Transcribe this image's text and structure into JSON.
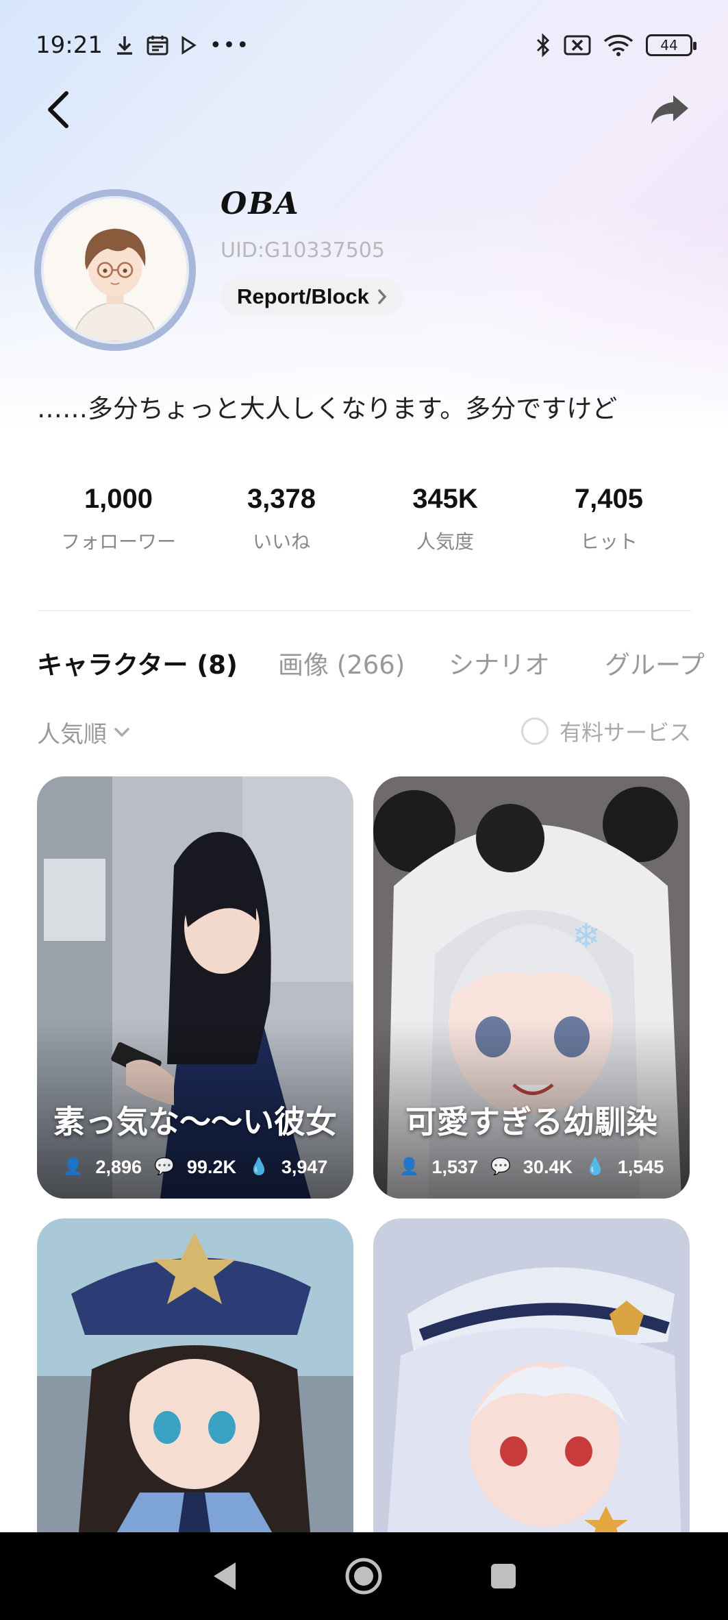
{
  "status_bar": {
    "time": "19:21",
    "battery": "44"
  },
  "profile": {
    "username": "OBA",
    "uid": "UID:G10337505",
    "report_label": "Report/Block",
    "bio": "……多分ちょっと大人しくなります。多分ですけど"
  },
  "stats": [
    {
      "value": "1,000",
      "label": "フォローワー"
    },
    {
      "value": "3,378",
      "label": "いいね"
    },
    {
      "value": "345K",
      "label": "人気度"
    },
    {
      "value": "7,405",
      "label": "ヒット"
    }
  ],
  "tabs": [
    {
      "label": "キャラクター (8)"
    },
    {
      "label": "画像 (266)"
    },
    {
      "label": "シナリオ"
    },
    {
      "label": "グループ"
    }
  ],
  "filters": {
    "sort_label": "人気順",
    "paid_label": "有料サービス"
  },
  "cards": [
    {
      "name": "素っ気な〜〜い彼女",
      "users": "2,896",
      "chats": "99.2K",
      "likes": "3,947"
    },
    {
      "name": "可愛すぎる幼馴染",
      "users": "1,537",
      "chats": "30.4K",
      "likes": "1,545"
    },
    {
      "name": "",
      "users": "",
      "chats": "",
      "likes": ""
    },
    {
      "name": "",
      "users": "",
      "chats": "",
      "likes": ""
    }
  ]
}
